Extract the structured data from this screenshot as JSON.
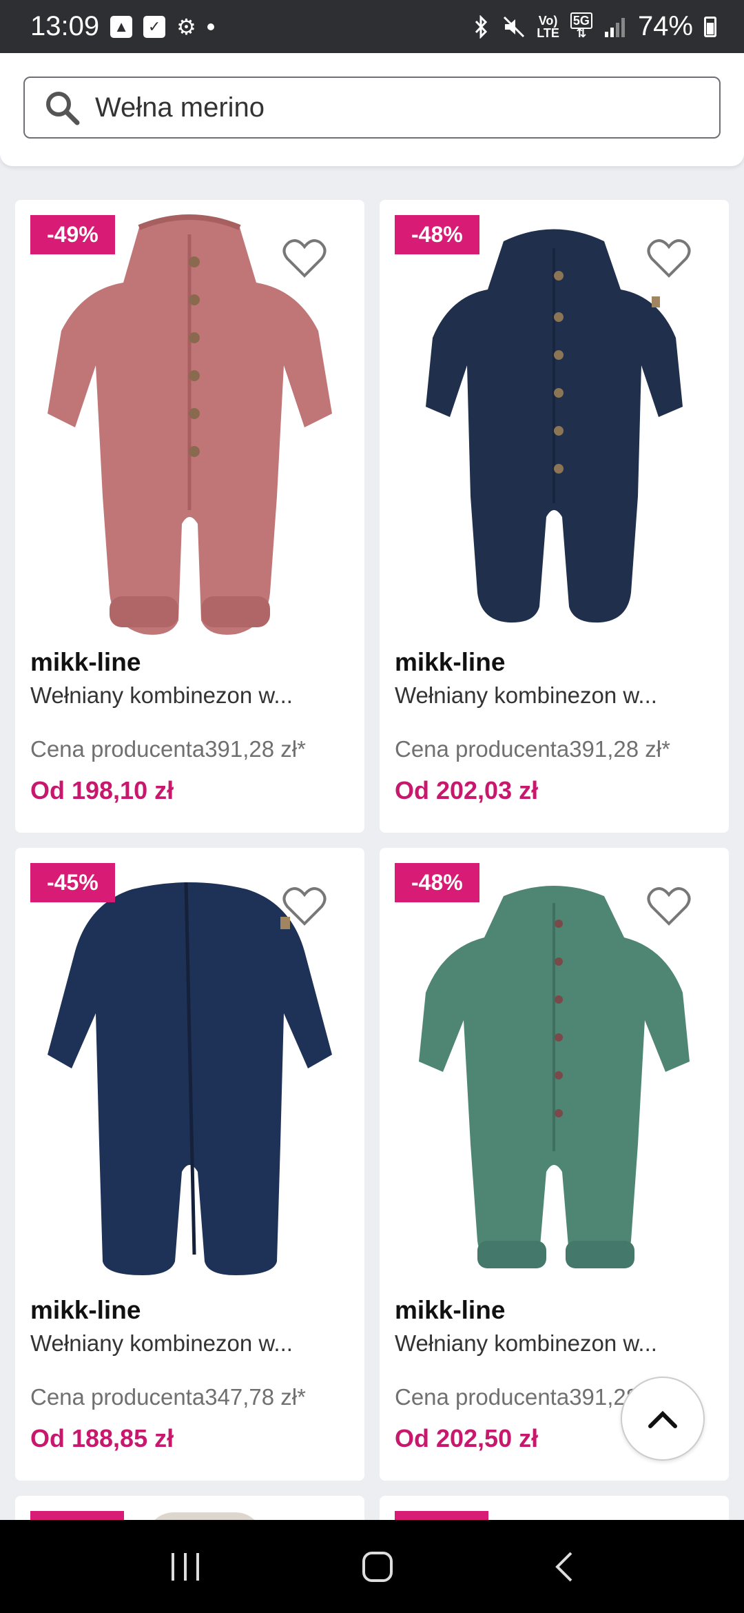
{
  "status_bar": {
    "time": "13:09",
    "network_label_1": "Vo)",
    "network_label_2": "LTE",
    "network_5g": "5G",
    "battery": "74%"
  },
  "search": {
    "value": "Wełna merino"
  },
  "colors": {
    "accent": "#d81b74",
    "price": "#c8186e"
  },
  "products": [
    {
      "discount": "-49%",
      "brand": "mikk-line",
      "name": "Wełniany kombinezon w...",
      "retail_price": "Cena producenta391,28 zł*",
      "price": "Od 198,10 zł",
      "color": "#c07676",
      "image_icon": "rose-wool-jumpsuit"
    },
    {
      "discount": "-48%",
      "brand": "mikk-line",
      "name": "Wełniany kombinezon w...",
      "retail_price": "Cena producenta391,28 zł*",
      "price": "Od 202,03 zł",
      "color": "#1f2f4c",
      "image_icon": "navy-wool-jumpsuit"
    },
    {
      "discount": "-45%",
      "brand": "mikk-line",
      "name": "Wełniany kombinezon w...",
      "retail_price": "Cena producenta347,78 zł*",
      "price": "Od 188,85 zł",
      "color": "#1e3156",
      "image_icon": "navy-zip-jumpsuit"
    },
    {
      "discount": "-48%",
      "brand": "mikk-line",
      "name": "Wełniany kombinezon w...",
      "retail_price": "Cena producenta391,28 zł*",
      "price": "Od 202,50 zł",
      "color": "#4e8673",
      "image_icon": "green-wool-jumpsuit"
    }
  ]
}
